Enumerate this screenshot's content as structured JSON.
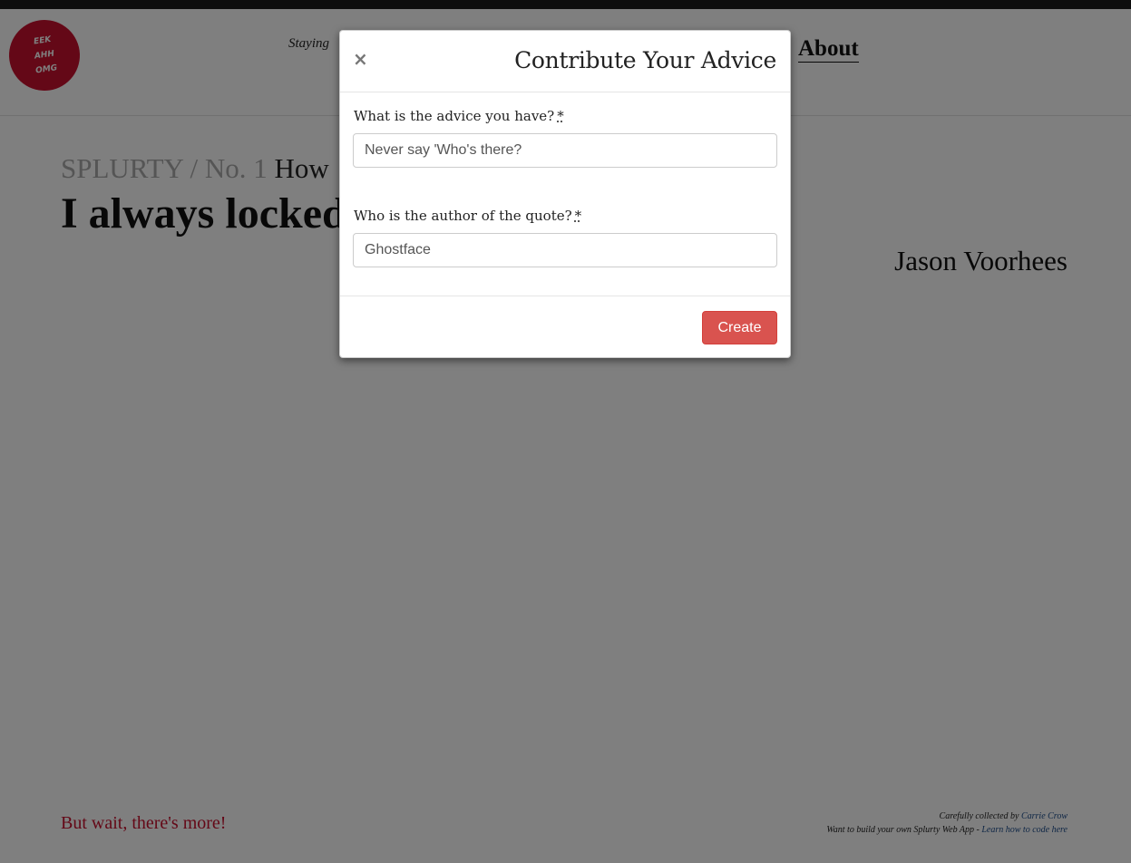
{
  "header": {
    "logo": {
      "line1": "EEK",
      "line2": "AHH",
      "line3": "OMG"
    },
    "tagline": "Staying",
    "nav": {
      "about": "About"
    }
  },
  "page": {
    "crumb_site": "SPLURTY / No. 1",
    "crumb_title": "How",
    "headline": "I always locked",
    "author": "Jason Voorhees",
    "more_link": "But wait, there's more!",
    "credits": {
      "collected_prefix": "Carefully collected by",
      "collected_name": "Carrie Crow",
      "build_prefix": "Want to build your own Splurty Web App -",
      "build_link": "Learn how to code here"
    }
  },
  "modal": {
    "close": "×",
    "title": "Contribute Your Advice",
    "advice_label": "What is the advice you have?",
    "advice_value": "Never say 'Who's there?",
    "author_label": "Who is the author of the quote?",
    "author_value": "Ghostface",
    "required_mark": "*",
    "create_label": "Create"
  },
  "colors": {
    "accent": "#c8102e",
    "button": "#d9534f",
    "overlay": "rgba(0,0,0,0.5)"
  }
}
